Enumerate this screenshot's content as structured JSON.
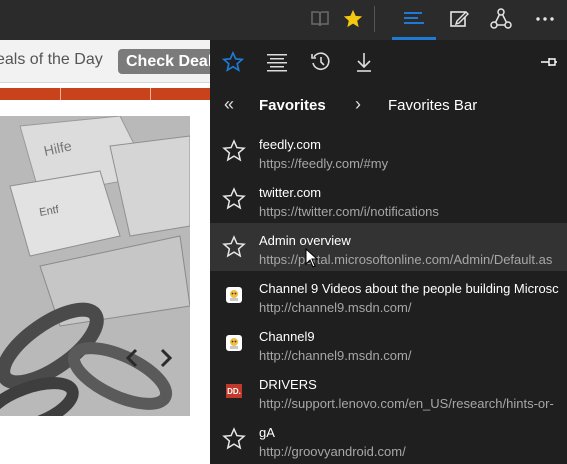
{
  "toolbar": {
    "icons": [
      "reading-view-icon",
      "favorites-star-icon",
      "hub-icon",
      "web-note-icon",
      "share-icon",
      "more-icon"
    ],
    "accent": "#1f7ad6",
    "star_color": "#f2c811"
  },
  "webpage": {
    "deals_text": "eals of the Day",
    "check_deal_label": "Check Deal",
    "accent_bar_color": "#c8421c"
  },
  "hub": {
    "tabs": [
      "favorites-tab",
      "reading-list-tab",
      "history-tab",
      "downloads-tab"
    ],
    "breadcrumb": {
      "back": "«",
      "current": "Favorites",
      "separator": "›",
      "folder": "Favorites Bar"
    },
    "items": [
      {
        "title": "feedly.com",
        "url": "https://feedly.com/#my",
        "icon": "star-outline"
      },
      {
        "title": "twitter.com",
        "url": "https://twitter.com/i/notifications",
        "icon": "star-outline"
      },
      {
        "title": "Admin overview",
        "url": "https://portal.microsoftonline.com/Admin/Default.as",
        "icon": "star-outline"
      },
      {
        "title": "Channel 9 Videos about the people building Microsc",
        "url": "http://channel9.msdn.com/",
        "icon": "channel9-favicon"
      },
      {
        "title": "Channel9",
        "url": "http://channel9.msdn.com/",
        "icon": "channel9-favicon"
      },
      {
        "title": "DRIVERS",
        "url": "http://support.lenovo.com/en_US/research/hints-or-",
        "icon": "lenovo-favicon"
      },
      {
        "title": "gA",
        "url": "http://groovyandroid.com/",
        "icon": "star-outline"
      }
    ],
    "lenovo_favicon_text": "DD."
  }
}
